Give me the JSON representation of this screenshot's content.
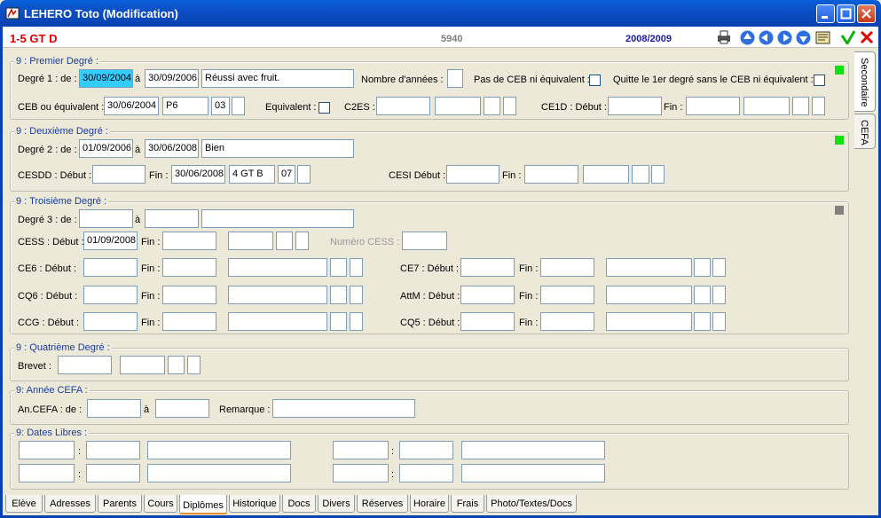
{
  "window": {
    "title": "LEHERO Toto (Modification)"
  },
  "info": {
    "class_code": "1-5 GT D",
    "student_number": "5940",
    "school_year": "2008/2009"
  },
  "colors": {
    "green_indicator": "#10e010",
    "grey_indicator": "#808080",
    "accent_red": "#e00000",
    "accent_blue": "#1a1aa6"
  },
  "premier": {
    "title": "9 : Premier Degré :",
    "degre1_label": "Degré 1 : de :",
    "from": "30/09/2004",
    "a_label": "à",
    "to": "30/09/2006",
    "comment": "Réussi avec fruit.",
    "nb_annees_label": "Nombre d'années :",
    "nb_annees": "",
    "pas_ceb_label": "Pas de CEB ni équivalent :",
    "quitte_label": "Quitte le 1er degré sans le CEB ni équivalent :",
    "ceb_label": "CEB ou équivalent :",
    "ceb_date": "30/06/2004",
    "ceb_code": "P6",
    "ceb_num": "03",
    "ceb_extra": "",
    "equivalent_label": "Equivalent :",
    "c2es_label": "C2ES :",
    "ce1d_label": "CE1D : Début :",
    "fin_label": "Fin :"
  },
  "deuxieme": {
    "title": "9 : Deuxième Degré :",
    "degre2_label": "Degré 2 : de :",
    "from": "01/09/2006",
    "a_label": "à",
    "to": "30/06/2008",
    "comment": "Bien",
    "cesdd_label": "CESDD : Début :",
    "fin_label": "Fin :",
    "cesdd_fin": "30/06/2008",
    "cesdd_class": "4 GT B",
    "cesdd_num": "07",
    "cesi_label": "CESI Début :",
    "cesi_fin_label": "Fin :"
  },
  "troisieme": {
    "title": "9 : Troisième Degré :",
    "degre3_label": "Degré 3 : de :",
    "a_label": "à",
    "cess_label": "CESS : Début :",
    "cess_debut": "01/09/2008",
    "fin_label": "Fin :",
    "numero_cess_label": "Numéro CESS :",
    "ce6_label": "CE6 : Début :",
    "ce7_label": "CE7 : Début :",
    "cq6_label": "CQ6 : Début :",
    "attm_label": "AttM : Début :",
    "ccg_label": "CCG : Début :",
    "cq5_label": "CQ5 : Début :"
  },
  "quatrieme": {
    "title": "9 : Quatrième Degré :",
    "brevet_label": "Brevet :"
  },
  "cefa": {
    "title": "9: Année CEFA :",
    "an_label": "An.CEFA : de :",
    "a_label": "à",
    "remarque_label": "Remarque :"
  },
  "dates_libres": {
    "title": "9: Dates Libres :",
    "colon": ":"
  },
  "side_tabs": [
    "Secondaire",
    "CEFA"
  ],
  "tabs": [
    "Elève",
    "Adresses",
    "Parents",
    "Cours",
    "Diplômes",
    "Historique",
    "Docs",
    "Divers",
    "Réserves",
    "Horaire",
    "Frais",
    "Photo/Textes/Docs"
  ],
  "active_tab": "Diplômes"
}
